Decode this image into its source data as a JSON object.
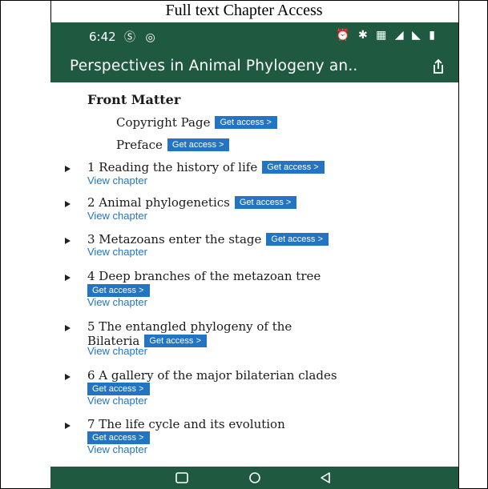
{
  "caption": "Full text Chapter Access",
  "status": {
    "time": "6:42",
    "left_icons": "Ⓢ ◎",
    "right_icons": "⏰ ✱ ▦ ◢ ◣ ▮"
  },
  "app": {
    "title": "Perspectives in Animal Phylogeny an.."
  },
  "front_matter": {
    "heading": "Front Matter",
    "items": [
      {
        "label": "Copyright Page",
        "access": "Get access >"
      },
      {
        "label": "Preface",
        "access": "Get access >"
      }
    ]
  },
  "chapters": [
    {
      "title": "1  Reading the history of life",
      "access": "Get access >",
      "view": "View chapter"
    },
    {
      "title": "2  Animal phylogenetics",
      "access": "Get access >",
      "view": "View chapter"
    },
    {
      "title": "3  Metazoans enter the stage",
      "access": "Get access >",
      "view": "View chapter"
    },
    {
      "title": "4  Deep branches of the metazoan tree",
      "access": "Get access >",
      "view": "View chapter"
    },
    {
      "title_line1": "5  The entangled phylogeny of the",
      "title_line2": "Bilateria",
      "access": "Get access >",
      "view": "View chapter"
    },
    {
      "title": "6  A gallery of the major bilaterian clades",
      "access": "Get access >",
      "view": "View chapter"
    },
    {
      "title": "7  The life cycle and its evolution",
      "access": "Get access >",
      "view": "View chapter"
    }
  ],
  "colors": {
    "appbar": "#1f5a40",
    "accent": "#2375c4"
  }
}
